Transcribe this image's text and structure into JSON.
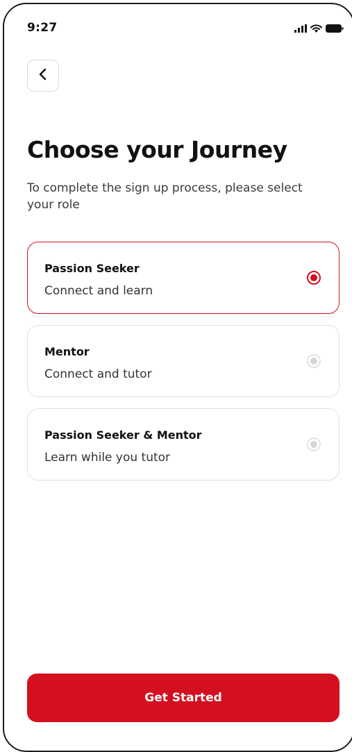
{
  "status_bar": {
    "time": "9:27",
    "icons": [
      "signal-icon",
      "wifi-icon",
      "battery-icon"
    ]
  },
  "navigation": {
    "back_icon": "chevron-left-icon"
  },
  "header": {
    "title": "Choose your Journey",
    "subtitle": "To complete the sign up process, please select your role"
  },
  "roles": [
    {
      "title": "Passion Seeker",
      "description": "Connect and learn",
      "selected": true
    },
    {
      "title": "Mentor",
      "description": "Connect and tutor",
      "selected": false
    },
    {
      "title": "Passion Seeker & Mentor",
      "description": "Learn while you tutor",
      "selected": false
    }
  ],
  "cta": {
    "label": "Get Started"
  },
  "colors": {
    "accent": "#d40f1f",
    "text": "#111111",
    "border": "#e0e0e0"
  }
}
